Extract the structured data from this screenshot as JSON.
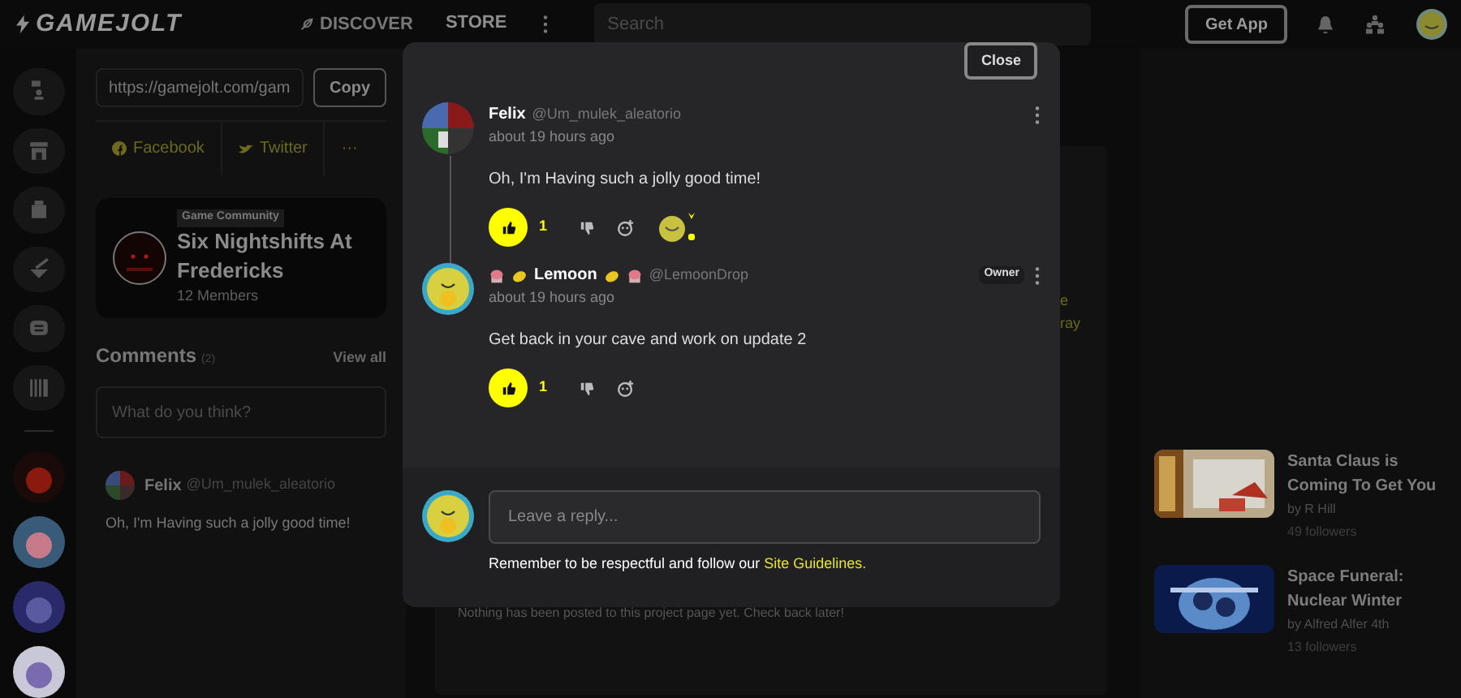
{
  "nav": {
    "logo": "GAMEJOLT",
    "links": [
      {
        "label": "DISCOVER",
        "selected": false
      },
      {
        "label": "STORE",
        "selected": true
      }
    ],
    "search": {
      "placeholder": "Search"
    },
    "get_app": "Get App"
  },
  "share": {
    "url": "https://gamejolt.com/gam",
    "copy": "Copy",
    "links": [
      "Facebook",
      "Twitter",
      "···"
    ]
  },
  "community": {
    "tag": "Game Community",
    "name": "Six Nightshifts At Fredericks",
    "members": "12 Members"
  },
  "comments": {
    "title": "Comments",
    "count": "(2)",
    "view_all": "View all",
    "placeholder": "What do you think?",
    "preview": {
      "name": "Felix",
      "handle": "@Um_mulek_aleatorio",
      "text": "Oh, I'm Having such a jolly good time!"
    }
  },
  "behind_text": [
    "e",
    "ray"
  ],
  "empty_note": "Nothing has been posted to this project page yet. Check back later!",
  "games": [
    {
      "title": "Santa Claus is Coming To Get You",
      "author": "by R Hill",
      "followers": "49 followers"
    },
    {
      "title": "Space Funeral: Nuclear Winter",
      "author": "by Alfred Alfer 4th",
      "followers": "13 followers"
    }
  ],
  "modal": {
    "close": "Close",
    "thread": [
      {
        "name": "Felix",
        "handle": "@Um_mulek_aleatorio",
        "flair": false,
        "time": "about 19 hours ago",
        "text": "Oh, I'm Having such a jolly good time!",
        "likes": "1",
        "liked": true,
        "has_reactions": true
      },
      {
        "name": "Lemoon",
        "handle": "@LemoonDrop",
        "flair": true,
        "time": "about 19 hours ago",
        "badge": "Owner",
        "text": "Get back in your cave and work on update 2",
        "likes": "1",
        "liked": true,
        "has_reactions": false
      }
    ],
    "reply_placeholder": "Leave a reply...",
    "guideline": "Remember to be respectful and follow our",
    "guideline_link": "Site Guidelines."
  }
}
